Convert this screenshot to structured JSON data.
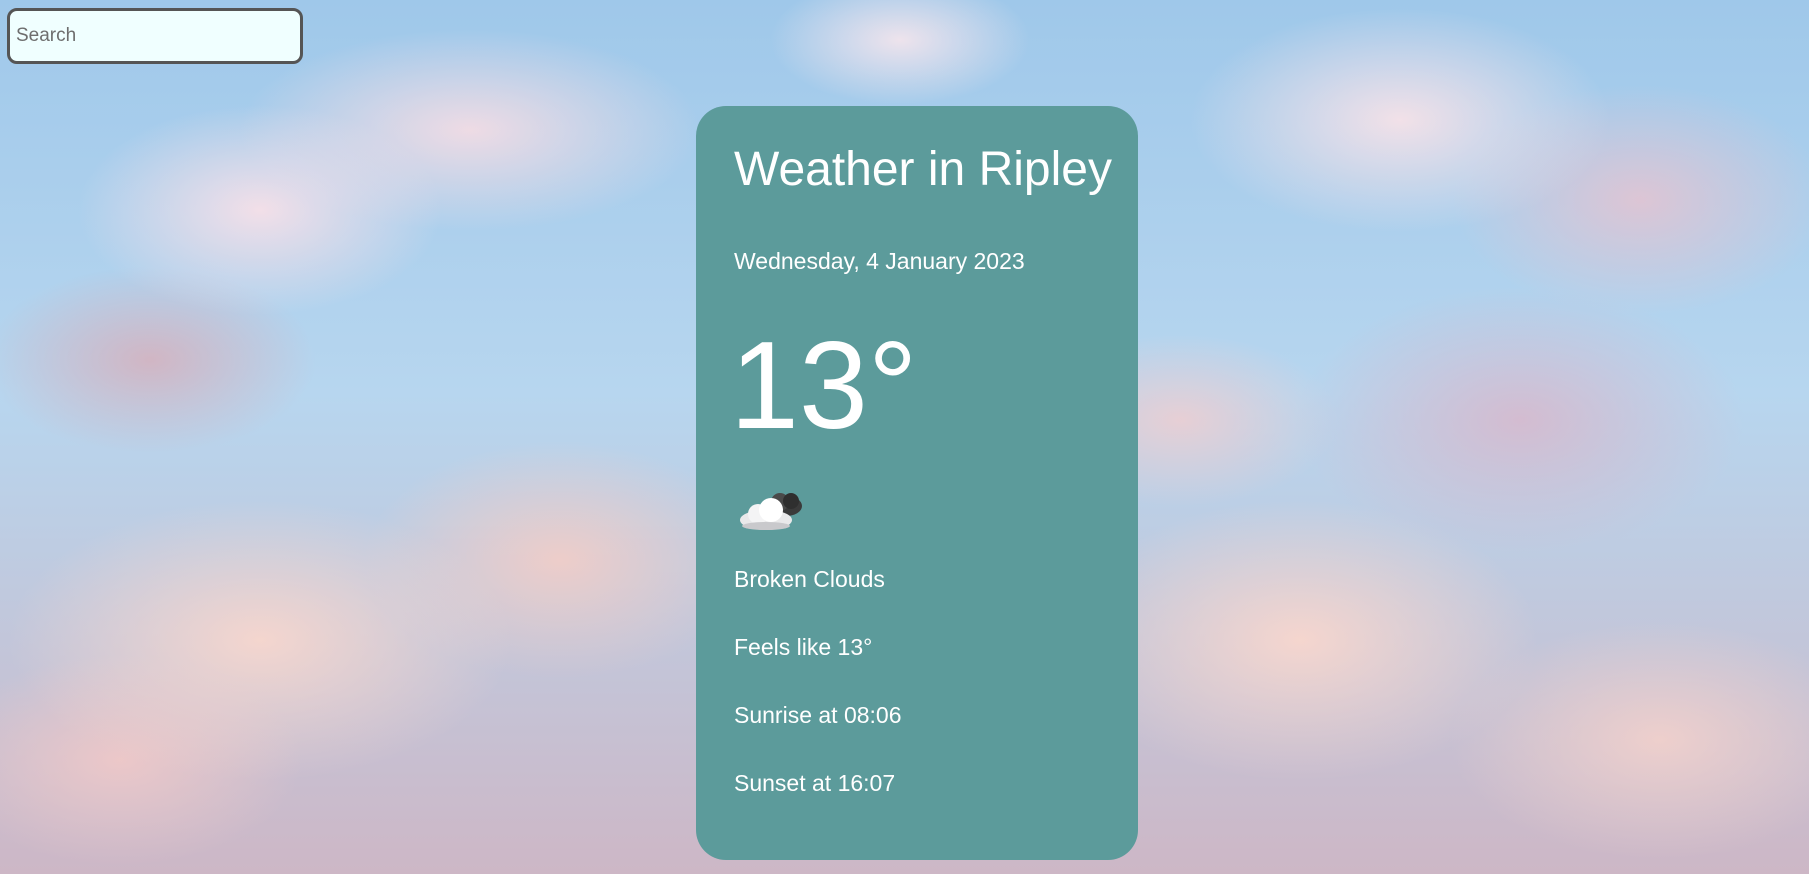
{
  "search": {
    "placeholder": "Search",
    "value": ""
  },
  "weather": {
    "title": "Weather in Ripley",
    "date": "Wednesday, 4 January 2023",
    "temperature": "13°",
    "icon": "cloud-icon",
    "description": "Broken Clouds",
    "feels_like": "Feels like 13°",
    "sunrise": "Sunrise at 08:06",
    "sunset": "Sunset at 16:07"
  },
  "colors": {
    "card_background": "#5c9b9b",
    "search_background": "#f0ffff",
    "text": "#ffffff"
  }
}
